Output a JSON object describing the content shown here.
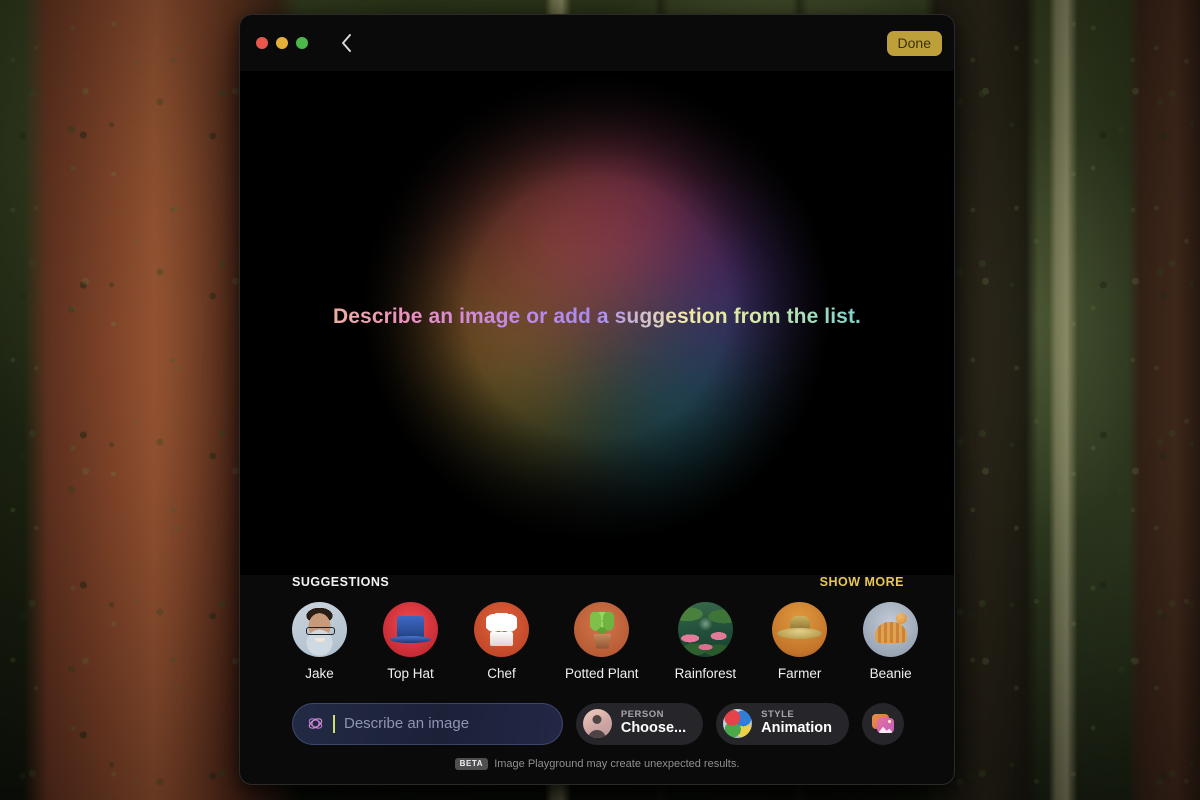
{
  "window": {
    "traffic_lights": [
      {
        "name": "close",
        "color": "#e9564b"
      },
      {
        "name": "minimize",
        "color": "#e4b03a"
      },
      {
        "name": "maximize",
        "color": "#4cb84a"
      }
    ],
    "back_icon": "chevron-left-icon",
    "done_label": "Done",
    "done_color": "#bda03a"
  },
  "hero": {
    "message": "Describe an image or add a suggestion from the list.",
    "gradient_colors": [
      "#f0c27a",
      "#e98fc0",
      "#a78cf0",
      "#f3e9a8",
      "#63b9d8"
    ]
  },
  "suggestions": {
    "title": "SUGGESTIONS",
    "show_more_label": "SHOW MORE",
    "show_more_color": "#e8c659",
    "items": [
      {
        "label": "Jake",
        "icon": "person-photo-icon"
      },
      {
        "label": "Top Hat",
        "icon": "top-hat-icon"
      },
      {
        "label": "Chef",
        "icon": "chef-hat-icon"
      },
      {
        "label": "Potted Plant",
        "icon": "potted-plant-icon"
      },
      {
        "label": "Rainforest",
        "icon": "rainforest-icon"
      },
      {
        "label": "Farmer",
        "icon": "farmer-hat-icon"
      },
      {
        "label": "Beanie",
        "icon": "beanie-icon"
      }
    ]
  },
  "toolbar": {
    "prompt": {
      "icon": "sparkle-atom-icon",
      "value": "",
      "placeholder": "Describe an image"
    },
    "person_pill": {
      "kicker": "PERSON",
      "value": "Choose...",
      "icon": "person-avatar-icon"
    },
    "style_pill": {
      "kicker": "STYLE",
      "value": "Animation",
      "icon": "color-sphere-icon"
    },
    "photos_button": {
      "icon": "photo-stack-icon"
    }
  },
  "footer": {
    "badge": "BETA",
    "disclaimer": "Image Playground may create unexpected results."
  }
}
